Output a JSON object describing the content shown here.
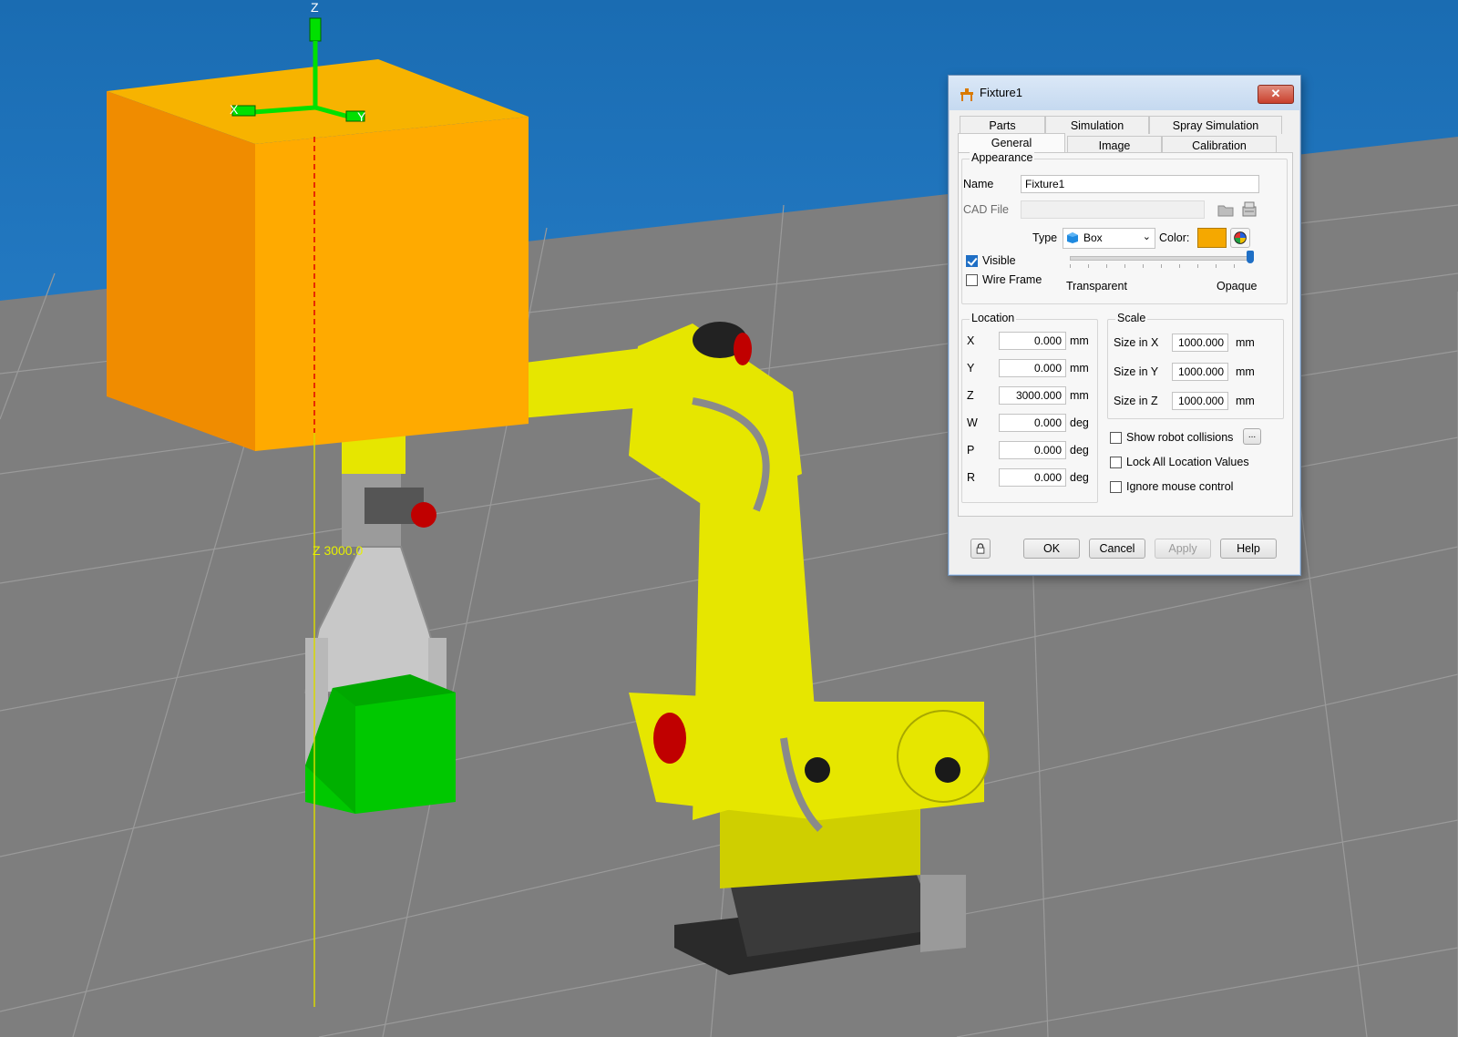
{
  "scene": {
    "axis_z_label": "Z",
    "axis_x_label": "X",
    "axis_y_label": "Y",
    "z_readout": "Z 3000.0",
    "colors": {
      "sky": "#1a6cb2",
      "floor": "#7e7e7e",
      "fixture_box": "#f5a800",
      "part_box": "#00c800",
      "robot": "#e6e600",
      "axes": "#00e000"
    }
  },
  "dialog": {
    "title": "Fixture1",
    "title_icon": "fixture-icon",
    "close_label": "✕",
    "tabs_row1": [
      "Parts",
      "Simulation",
      "Spray Simulation"
    ],
    "tabs_row2": [
      "General",
      "Image",
      "Calibration"
    ],
    "active_tab": "General",
    "appearance": {
      "group_title": "Appearance",
      "name_label": "Name",
      "name_value": "Fixture1",
      "cad_file_label": "CAD File",
      "cad_file_value": "",
      "type_label": "Type",
      "type_value": "Box",
      "color_label": "Color:",
      "color_value": "#f5a800",
      "visible_label": "Visible",
      "visible_checked": true,
      "wireframe_label": "Wire Frame",
      "wireframe_checked": false,
      "transparency_min_label": "Transparent",
      "transparency_max_label": "Opaque",
      "transparency_level": 1.0
    },
    "location": {
      "group_title": "Location",
      "fields": [
        {
          "label": "X",
          "value": "0.000",
          "unit": "mm"
        },
        {
          "label": "Y",
          "value": "0.000",
          "unit": "mm"
        },
        {
          "label": "Z",
          "value": "3000.000",
          "unit": "mm"
        },
        {
          "label": "W",
          "value": "0.000",
          "unit": "deg"
        },
        {
          "label": "P",
          "value": "0.000",
          "unit": "deg"
        },
        {
          "label": "R",
          "value": "0.000",
          "unit": "deg"
        }
      ]
    },
    "scale": {
      "group_title": "Scale",
      "fields": [
        {
          "label": "Size in X",
          "value": "1000.000",
          "unit": "mm"
        },
        {
          "label": "Size in Y",
          "value": "1000.000",
          "unit": "mm"
        },
        {
          "label": "Size in Z",
          "value": "1000.000",
          "unit": "mm"
        }
      ]
    },
    "options": {
      "show_collisions_label": "Show robot collisions",
      "show_collisions_btn": "...",
      "lock_location_label": "Lock All Location Values",
      "ignore_mouse_label": "Ignore mouse control"
    },
    "buttons": {
      "ok": "OK",
      "cancel": "Cancel",
      "apply": "Apply",
      "help": "Help"
    }
  }
}
